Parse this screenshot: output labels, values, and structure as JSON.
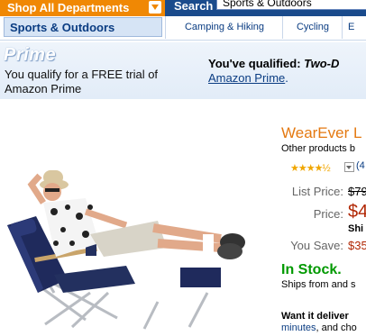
{
  "header": {
    "departments_label": "Shop All Departments",
    "search_label": "Search",
    "search_value": "Sports & Outdoors"
  },
  "nav": {
    "store_name": "Sports & Outdoors",
    "links": [
      "Camping & Hiking",
      "Cycling",
      "E"
    ]
  },
  "prime": {
    "logo": "Prime",
    "trial_text": "You qualify for a FREE trial of Amazon Prime",
    "qualified_prefix": "You've qualified: ",
    "qualified_emphasis": "Two-D",
    "prime_link": "Amazon Prime",
    "prime_link_suffix": "."
  },
  "product": {
    "title": "WearEver L",
    "other_products": "Other products b",
    "rating_stars": "★★★★½",
    "review_count": "(4",
    "list_price_label": "List Price:",
    "list_price": "$79",
    "price_label": "Price:",
    "price": "$4",
    "shipping": "Shi",
    "you_save_label": "You Save:",
    "you_save": "$35",
    "stock": "In Stock.",
    "ships_from": "Ships from and s",
    "deliver_heading": "Want it deliver",
    "deliver_link": "minutes",
    "deliver_rest": ", and cho"
  },
  "colors": {
    "accent_orange": "#f08804",
    "nav_blue": "#1a4b8c",
    "price_red": "#b12704",
    "stock_green": "#009900",
    "title_orange": "#e47911"
  }
}
